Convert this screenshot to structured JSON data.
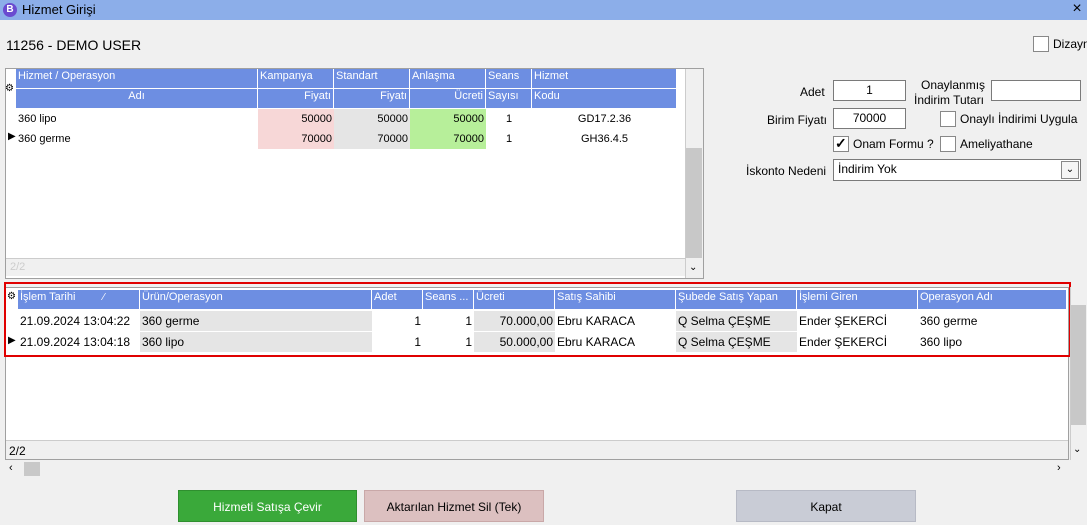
{
  "window": {
    "icon": "B",
    "title": "Hizmet Girişi",
    "close": "×"
  },
  "user": "11256 - DEMO USER",
  "dizayn_label": "Dizayn",
  "form": {
    "adet_label": "Adet",
    "adet_value": "1",
    "onayli_label_1": "Onaylanmış",
    "onayli_label_2": "İndirim Tutarı",
    "onayli_value": "",
    "birim_label": "Birim Fiyatı",
    "birim_value": "70000",
    "onayli_indirim_label": "Onaylı İndirimi Uygula",
    "onam_label": "Onam Formu ?",
    "ameliyathane_label": "Ameliyathane",
    "iskonto_label": "İskonto Nedeni",
    "iskonto_value": "İndirim Yok"
  },
  "top_grid": {
    "headers_row1": [
      "Hizmet / Operasyon",
      "Kampanya",
      "Standart",
      "Anlaşma",
      "Seans",
      "Hizmet"
    ],
    "headers_row2": [
      "Adı",
      "Fiyatı",
      "Fiyatı",
      "Ücreti",
      "Sayısı",
      "Kodu"
    ],
    "rows": [
      {
        "ad": "360 lipo",
        "kampanya": "50000",
        "standart": "50000",
        "anlasma": "50000",
        "seans": "1",
        "kod": "GD17.2.36"
      },
      {
        "ad": "360 germe",
        "kampanya": "70000",
        "standart": "70000",
        "anlasma": "70000",
        "seans": "1",
        "kod": "GH36.4.5"
      }
    ],
    "footer": "2/2"
  },
  "bottom_grid": {
    "headers": [
      "İşlem Tarihi",
      "Ürün/Operasyon",
      "Adet",
      "Seans ...",
      "Ücreti",
      "Satış Sahibi",
      "Şubede Satış Yapan",
      "İşlemi Giren",
      "Operasyon Adı"
    ],
    "rows": [
      {
        "tarih": "21.09.2024 13:04:22",
        "urun": "360 germe",
        "adet": "1",
        "seans": "1",
        "ucret": "70.000,00",
        "sahibi": "Ebru KARACA",
        "subede": "Q Selma ÇEŞME",
        "giren": "Ender ŞEKERCİ",
        "opadi": "360 germe"
      },
      {
        "tarih": "21.09.2024 13:04:18",
        "urun": "360 lipo",
        "adet": "1",
        "seans": "1",
        "ucret": "50.000,00",
        "sahibi": "Ebru KARACA",
        "subede": "Q Selma ÇEŞME",
        "giren": "Ender ŞEKERCİ",
        "opadi": "360 lipo"
      }
    ],
    "footer": "2/2"
  },
  "buttons": {
    "satisa_cevir": "Hizmeti Satışa Çevir",
    "sil": "Aktarılan Hizmet Sil (Tek)",
    "kapat": "Kapat"
  },
  "colors": {
    "header": "#6d8ee2",
    "titlebar": "#8caee9",
    "btn_green": "#3aa93a",
    "btn_pink": "#dcc0c0",
    "btn_grey": "#c9ccd6"
  }
}
